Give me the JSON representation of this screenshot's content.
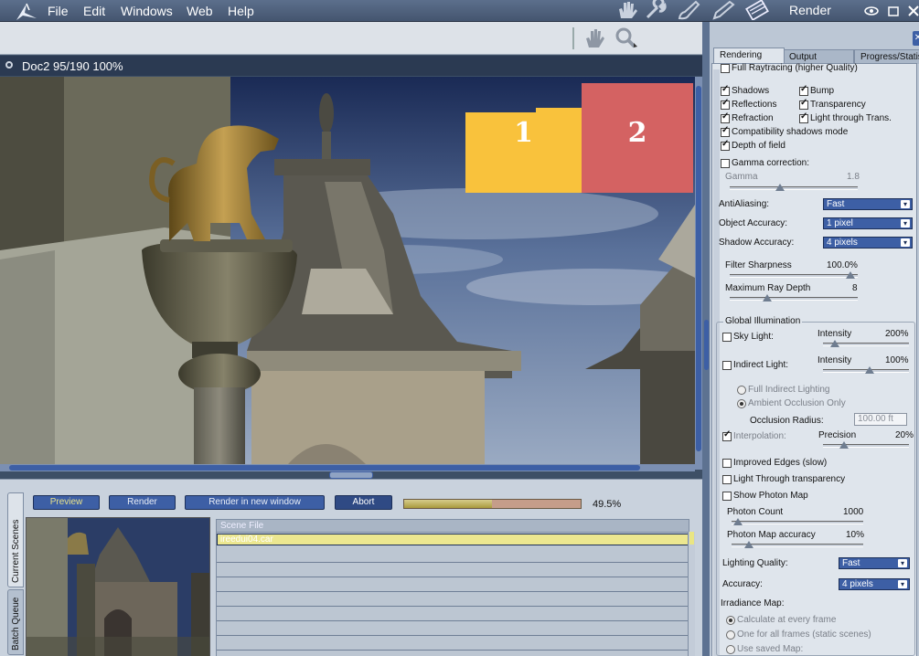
{
  "menubar": {
    "items": [
      "File",
      "Edit",
      "Windows",
      "Web",
      "Help"
    ],
    "tools": [
      "hand-tool-icon",
      "wrench-tool-icon",
      "brush-tool-icon",
      "pencil-tool-icon",
      "film-tool-icon"
    ],
    "panel_title": "Render"
  },
  "document": {
    "title": "Doc2 95/190 100%"
  },
  "callouts": [
    "1",
    "2"
  ],
  "render_controls": {
    "preview": "Preview",
    "render": "Render",
    "render_new_window": "Render in new window",
    "abort": "Abort",
    "progress": 0.495,
    "progress_label": "49.5%"
  },
  "scene_tabs": {
    "current": "Current Scenes",
    "batch": "Batch Queue"
  },
  "scene_list": {
    "header": "Scene File",
    "rows": [
      "ireedui04.car",
      "",
      "",
      "",
      "",
      "",
      "",
      ""
    ]
  },
  "render_panel": {
    "tabs": [
      "Rendering",
      "Output",
      "Progress/Statistics"
    ],
    "full_raytracing": "Full Raytracing (higher Quality)",
    "shadows": "Shadows",
    "bump": "Bump",
    "reflections": "Reflections",
    "transparency": "Transparency",
    "refraction": "Refraction",
    "light_through_trans": "Light through Trans.",
    "compat_shadows": "Compatibility shadows mode",
    "depth_of_field": "Depth of field",
    "gamma_correction": "Gamma correction:",
    "gamma_label": "Gamma",
    "gamma_value": "1.8",
    "antialiasing_label": "AntiAliasing:",
    "antialiasing_value": "Fast",
    "object_accuracy_label": "Object Accuracy:",
    "object_accuracy_value": "1 pixel",
    "shadow_accuracy_label": "Shadow Accuracy:",
    "shadow_accuracy_value": "4 pixels",
    "filter_sharpness_label": "Filter Sharpness",
    "filter_sharpness_value": "100.0%",
    "max_ray_depth_label": "Maximum Ray Depth",
    "max_ray_depth_value": "8",
    "gi_title": "Global Illumination",
    "sky_light": "Sky Light:",
    "sky_intensity_label": "Intensity",
    "sky_intensity_value": "200%",
    "indirect_light": "Indirect Light:",
    "indirect_intensity_label": "Intensity",
    "indirect_intensity_value": "100%",
    "full_indirect": "Full Indirect Lighting",
    "ambient_occlusion": "Ambient Occlusion Only",
    "occlusion_radius_label": "Occlusion Radius:",
    "occlusion_radius_value": "100.00 ft",
    "interpolation": "Interpolation:",
    "precision_label": "Precision",
    "precision_value": "20%",
    "improved_edges": "Improved Edges (slow)",
    "light_through_transparency": "Light Through transparency",
    "show_photon_map": "Show Photon Map",
    "photon_count_label": "Photon Count",
    "photon_count_value": "1000",
    "photon_accuracy_label": "Photon Map accuracy",
    "photon_accuracy_value": "10%",
    "lighting_quality_label": "Lighting Quality:",
    "lighting_quality_value": "Fast",
    "accuracy_label": "Accuracy:",
    "accuracy_value": "4 pixels",
    "irradiance_map": "Irradiance Map:",
    "calc_every_frame": "Calculate at every frame",
    "one_for_all": "One for all frames (static scenes)",
    "use_saved_map": "Use saved Map:"
  },
  "colors": {
    "accent": "#3d5fa5",
    "callout_1": "#f9c23c",
    "callout_2": "#d46262",
    "selected_row": "#ece790"
  }
}
